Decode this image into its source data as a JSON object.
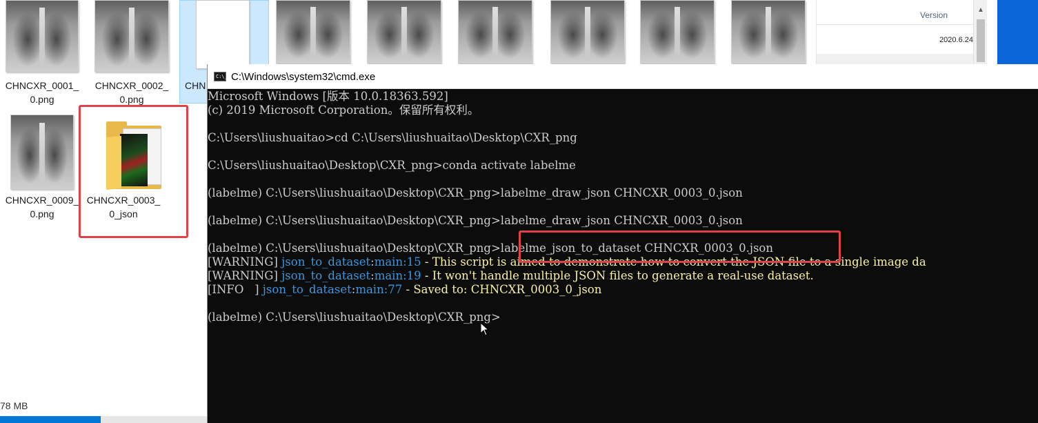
{
  "explorer": {
    "files": [
      {
        "name_line1": "CHNCXR_0001_",
        "name_line2": "0.png",
        "type": "xray"
      },
      {
        "name_line1": "CHNCXR_0002_",
        "name_line2": "0.png",
        "type": "xray"
      },
      {
        "name_line1": "CHN",
        "name_line2": "",
        "type": "file"
      },
      {
        "name_line1": "CHNCXR_0009_",
        "name_line2": "0.png",
        "type": "xray"
      },
      {
        "name_line1": "CHNCXR_0003_",
        "name_line2": "0_json",
        "type": "folder"
      }
    ],
    "status_size": "78 MB"
  },
  "details_pane": {
    "column_header": "Version",
    "version_value": "2020.6.24",
    "scroll_up_icon": "chevron-up-icon"
  },
  "cmd_window": {
    "title": "C:\\Windows\\system32\\cmd.exe",
    "icon_label": "C:\\_",
    "lines": [
      "Microsoft Windows [版本 10.0.18363.592]",
      "(c) 2019 Microsoft Corporation。保留所有权利。",
      "",
      "C:\\Users\\liushuaitao>cd C:\\Users\\liushuaitao\\Desktop\\CXR_png",
      "",
      "C:\\Users\\liushuaitao\\Desktop\\CXR_png>conda activate labelme",
      "",
      "(labelme) C:\\Users\\liushuaitao\\Desktop\\CXR_png>labelme_draw_json CHNCXR_0003_0.json",
      "",
      "(labelme) C:\\Users\\liushuaitao\\Desktop\\CXR_png>labelme_draw_json CHNCXR_0003_0.json",
      "",
      "(labelme) C:\\Users\\liushuaitao\\Desktop\\CXR_png>labelme_json_to_dataset CHNCXR_0003_0.json"
    ],
    "log_lines": [
      {
        "level": "[WARNING]",
        "source": "json_to_dataset",
        "sep": ":",
        "func": "main",
        "lineno": ":15",
        "msg": " - This script is aimed to demonstrate how to convert the JSON file to a single image da"
      },
      {
        "level": "[WARNING]",
        "source": "json_to_dataset",
        "sep": ":",
        "func": "main",
        "lineno": ":19",
        "msg": " - It won't handle multiple JSON files to generate a real-use dataset."
      },
      {
        "level": "[INFO   ]",
        "source": "json_to_dataset",
        "sep": ":",
        "func": "main",
        "lineno": ":77",
        "msg": " - Saved to: CHNCXR_0003_0_json"
      }
    ],
    "prompt_line": "(labelme) C:\\Users\\liushuaitao\\Desktop\\CXR_png>"
  },
  "colors": {
    "highlight_box": "#e0424a",
    "console_bg": "#0c0c0c",
    "console_text": "#cccccc",
    "log_source": "#3a96dd",
    "log_message": "#f9f1a5",
    "selection": "#cce8ff"
  }
}
